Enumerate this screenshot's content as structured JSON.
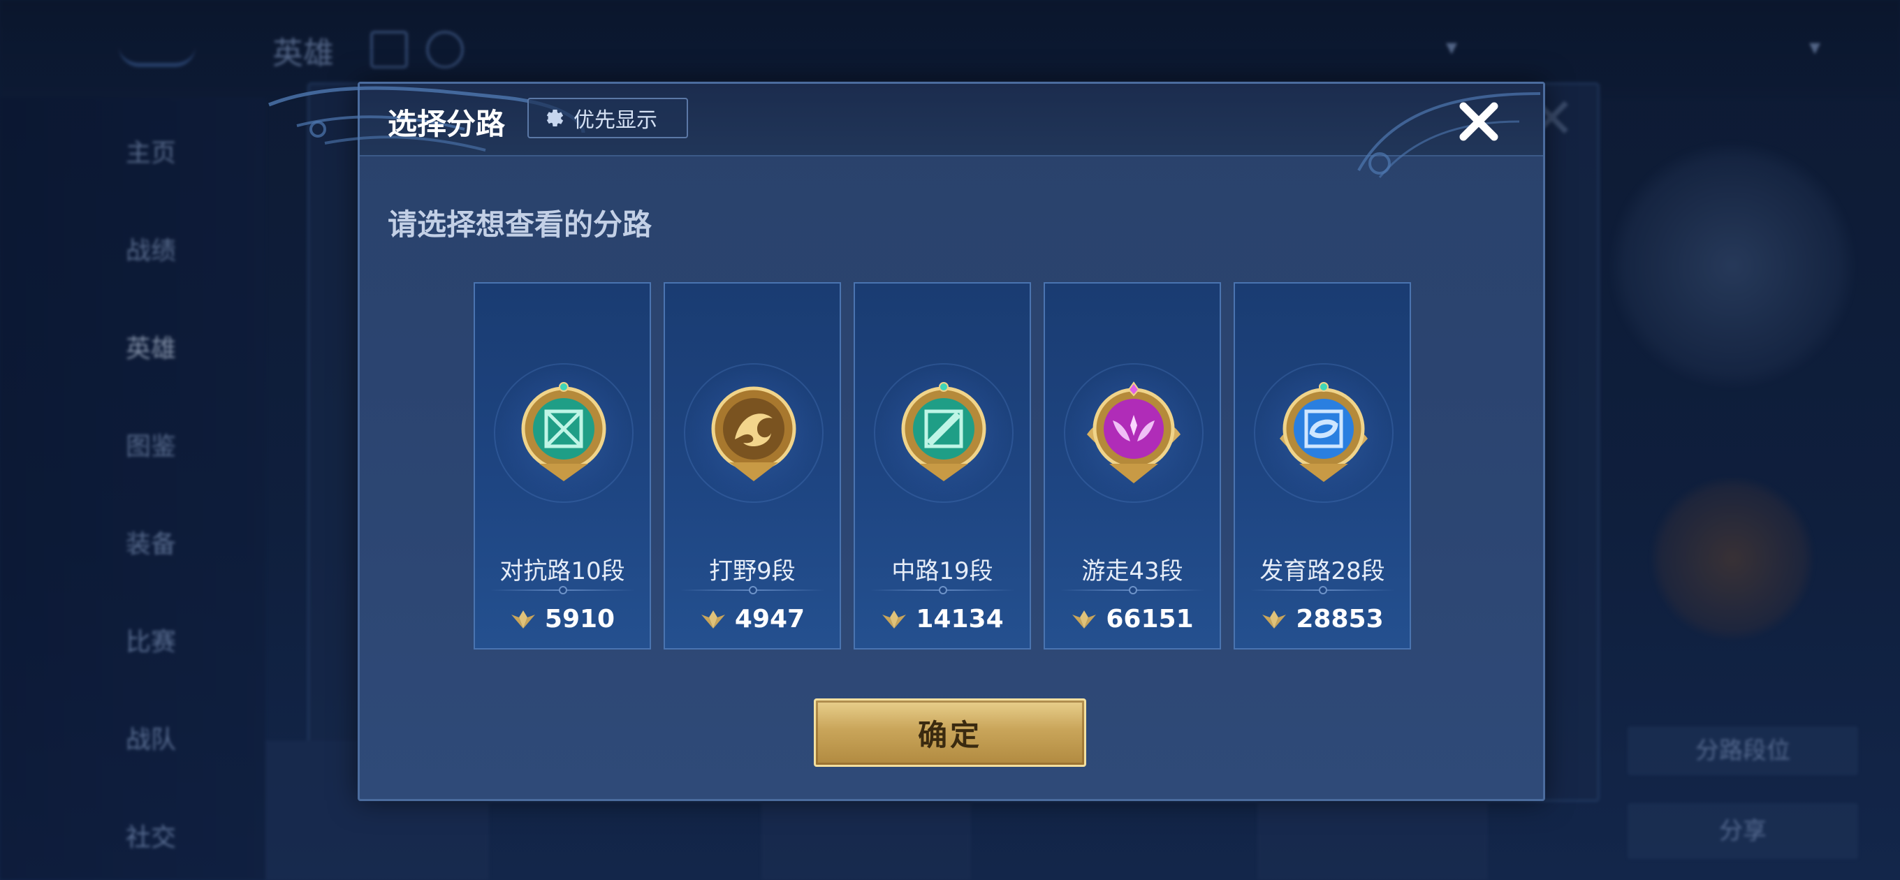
{
  "background": {
    "top_title": "英雄",
    "sidebar_items": [
      "主页",
      "战绩",
      "英雄",
      "图鉴",
      "装备",
      "比赛",
      "战队",
      "社交"
    ],
    "right_button": "分路段位",
    "right_button2": "分享"
  },
  "modal": {
    "title": "选择分路",
    "priority_label": "优先显示",
    "subtitle": "请选择想查看的分路",
    "confirm_label": "确定"
  },
  "lanes": [
    {
      "label": "对抗路10段",
      "score": "5910",
      "icon": "clash-lane-badge-icon",
      "color": "#2fc3a0"
    },
    {
      "label": "打野9段",
      "score": "4947",
      "icon": "jungle-dragon-badge-icon",
      "color": "#c8923c"
    },
    {
      "label": "中路19段",
      "score": "14134",
      "icon": "mid-lane-badge-icon",
      "color": "#2fc3a0"
    },
    {
      "label": "游走43段",
      "score": "66151",
      "icon": "roam-badge-icon",
      "color": "#c63cc8"
    },
    {
      "label": "发育路28段",
      "score": "28853",
      "icon": "farm-lane-badge-icon",
      "color": "#2f8ff0"
    }
  ],
  "colors": {
    "accent_gold": "#c9a55a",
    "panel": "#2b4470",
    "card": "#1e4582"
  }
}
